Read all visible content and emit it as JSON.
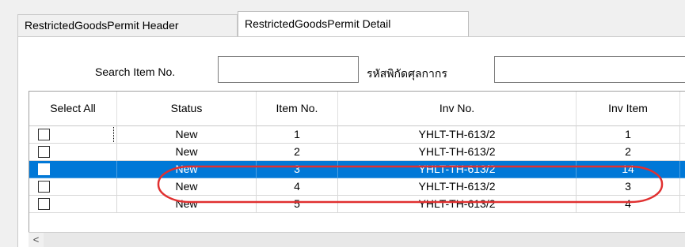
{
  "tabs": [
    {
      "label": "RestrictedGoodsPermit Header",
      "active": false
    },
    {
      "label": "RestrictedGoodsPermit Detail",
      "active": true
    }
  ],
  "search": {
    "item_no_label": "Search Item No.",
    "item_no_value": "",
    "tariff_label": "รหัสพิกัดศุลกากร",
    "tariff_value": ""
  },
  "grid": {
    "columns": [
      "Select All",
      "Status",
      "Item No.",
      "Inv No.",
      "Inv Item"
    ],
    "rows": [
      {
        "status": "New",
        "item_no": "1",
        "inv_no": "YHLT-TH-613/2",
        "inv_item": "1",
        "checked": false,
        "selected": false
      },
      {
        "status": "New",
        "item_no": "2",
        "inv_no": "YHLT-TH-613/2",
        "inv_item": "2",
        "checked": false,
        "selected": false
      },
      {
        "status": "New",
        "item_no": "3",
        "inv_no": "YHLT-TH-613/2",
        "inv_item": "14",
        "checked": false,
        "selected": true
      },
      {
        "status": "New",
        "item_no": "4",
        "inv_no": "YHLT-TH-613/2",
        "inv_item": "3",
        "checked": false,
        "selected": false
      },
      {
        "status": "New",
        "item_no": "5",
        "inv_no": "YHLT-TH-613/2",
        "inv_item": "4",
        "checked": false,
        "selected": false
      }
    ]
  },
  "scrollbar": {
    "left_arrow": "<"
  },
  "colors": {
    "selection": "#0078d7",
    "annotation": "#e03030",
    "background": "#f0f0f0"
  }
}
